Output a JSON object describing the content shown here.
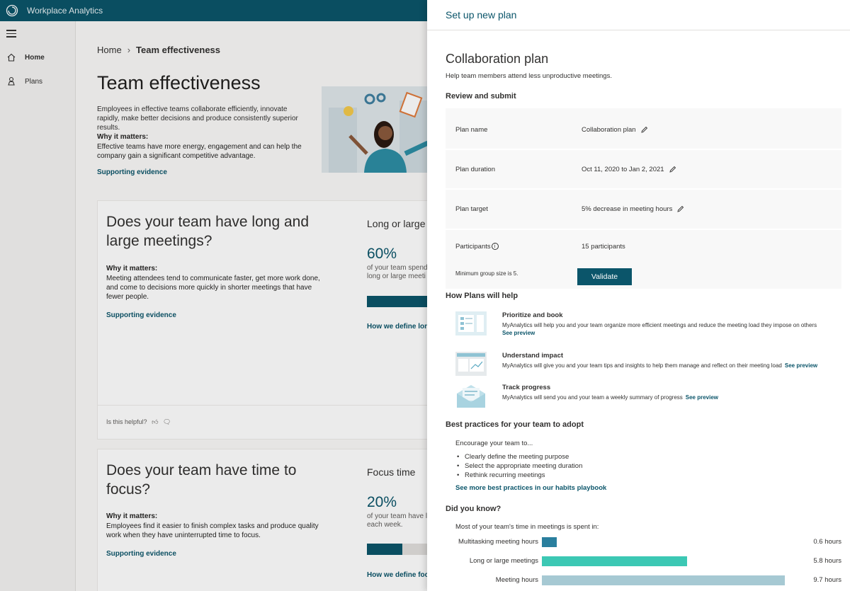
{
  "app": {
    "title": "Workplace Analytics"
  },
  "nav": {
    "items": [
      {
        "label": "Home",
        "icon": "home-icon"
      },
      {
        "label": "Plans",
        "icon": "plans-icon"
      }
    ]
  },
  "breadcrumb": {
    "home": "Home",
    "current": "Team effectiveness"
  },
  "page": {
    "title": "Team effectiveness",
    "intro": "Employees in effective teams collaborate efficiently, innovate rapidly, make better decisions and produce consistently superior results.",
    "why_heading": "Why it matters:",
    "why_text": "Effective teams have more energy, engagement and can help the company gain a significant competitive advantage.",
    "evidence": "Supporting evidence"
  },
  "cards": [
    {
      "title": "Does your team have long and large meetings?",
      "why_heading": "Why it matters:",
      "why_text": "Meeting attendees tend to communicate faster, get more work done, and come to decisions more quickly in shorter meetings that have fewer people.",
      "evidence": "Supporting evidence",
      "side_title": "Long or large",
      "percent": "60%",
      "percent_desc_1": "of your team spends",
      "percent_desc_2": "long or large meeti",
      "bar_fraction": 1.0,
      "define_link": "How we define long",
      "helpful": "Is this helpful?"
    },
    {
      "title": "Does your team have time to focus?",
      "why_heading": "Why it matters:",
      "why_text": "Employees find it easier to finish complex tasks and produce quality work when they have uninterrupted time to focus.",
      "evidence": "Supporting evidence",
      "side_title": "Focus time",
      "percent": "20%",
      "percent_desc_1": "of your team have le",
      "percent_desc_2": "each week.",
      "bar_fraction": 0.55,
      "define_link": "How we define focu"
    }
  ],
  "panel": {
    "header": "Set up new plan",
    "title": "Collaboration plan",
    "subtitle": "Help team members attend less unproductive meetings.",
    "review_heading": "Review and submit",
    "review": {
      "plan_name_label": "Plan name",
      "plan_name_value": "Collaboration plan",
      "duration_label": "Plan duration",
      "duration_value": "Oct 11, 2020 to Jan 2, 2021",
      "target_label": "Plan target",
      "target_value": "5% decrease in meeting hours",
      "participants_label": "Participants",
      "participants_value": "15 participants",
      "min_group": "Minimum group size is 5.",
      "validate": "Validate"
    },
    "how_heading": "How Plans will help",
    "help_items": [
      {
        "title": "Prioritize and book",
        "desc": "MyAnalytics will help you and your team organize more efficient meetings and reduce the meeting load they impose on others",
        "link": "See preview"
      },
      {
        "title": "Understand impact",
        "desc": "MyAnalytics will give you and your team tips and insights to help them manage and reflect on their meeting load",
        "link": "See preview"
      },
      {
        "title": "Track progress",
        "desc": "MyAnalytics will send you and your team a weekly summary of progress",
        "link": "See preview"
      }
    ],
    "best_heading": "Best practices for your team to adopt",
    "encourage": "Encourage your team to...",
    "practices": [
      "Clearly define the meeting purpose",
      "Select the appropriate meeting duration",
      "Rethink recurring meetings"
    ],
    "best_more": "See more best practices in our habits playbook",
    "dyk_heading": "Did you know?",
    "dyk_sub": "Most of your team's time in meetings is spent in:",
    "colors": {
      "accent": "#0b556a",
      "multitask": "#2a7f9e",
      "long": "#3cc8b4",
      "meeting": "#a6c9d3"
    }
  },
  "chart_data": {
    "type": "bar",
    "orientation": "horizontal",
    "categories": [
      "Multitasking meeting hours",
      "Long or large meetings",
      "Meeting hours"
    ],
    "values": [
      0.6,
      5.8,
      9.7
    ],
    "value_labels": [
      "0.6 hours",
      "5.8 hours",
      "9.7 hours"
    ],
    "colors": [
      "#2a7f9e",
      "#3cc8b4",
      "#a6c9d3"
    ],
    "xlim": [
      0,
      9.7
    ]
  }
}
